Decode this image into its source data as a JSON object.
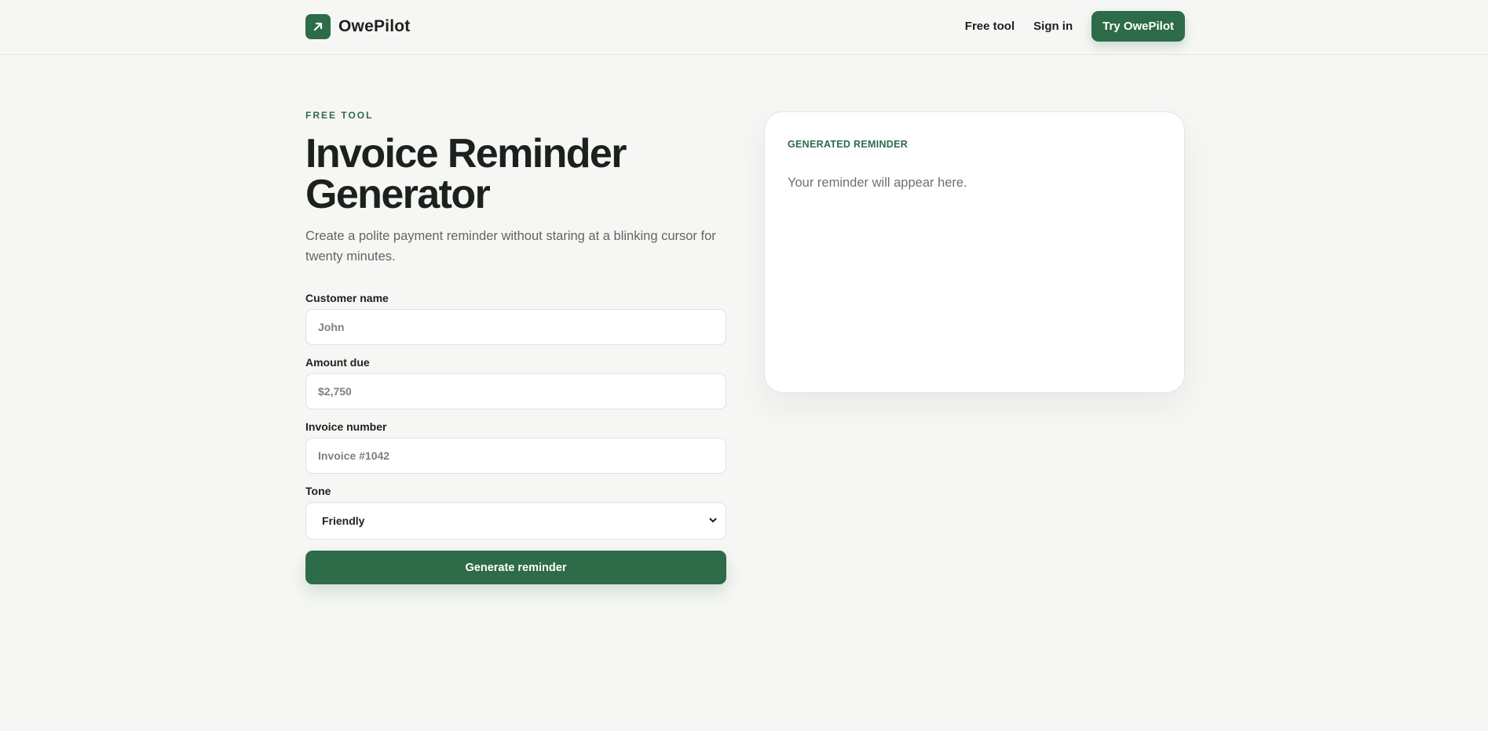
{
  "header": {
    "brand_name": "OwePilot",
    "brand_icon": "arrow-up-right-icon",
    "nav": {
      "free_tool": "Free tool",
      "sign_in": "Sign in",
      "cta": "Try OwePilot"
    }
  },
  "hero": {
    "eyebrow": "FREE TOOL",
    "title_line1": "Invoice Reminder",
    "title_line2": "Generator",
    "subtitle": "Create a polite payment reminder without staring at a blinking cursor for twenty minutes."
  },
  "form": {
    "customer_name": {
      "label": "Customer name",
      "placeholder": "John"
    },
    "amount_due": {
      "label": "Amount due",
      "placeholder": "$2,750"
    },
    "invoice_number": {
      "label": "Invoice number",
      "placeholder": "Invoice #1042"
    },
    "tone": {
      "label": "Tone",
      "selected": "Friendly"
    },
    "generate_label": "Generate reminder"
  },
  "result": {
    "eyebrow": "GENERATED REMINDER",
    "placeholder": "Your reminder will appear here."
  },
  "colors": {
    "accent": "#2e6b48",
    "background": "#f6f7f5",
    "text": "#1b211d",
    "muted": "#5f6761"
  }
}
